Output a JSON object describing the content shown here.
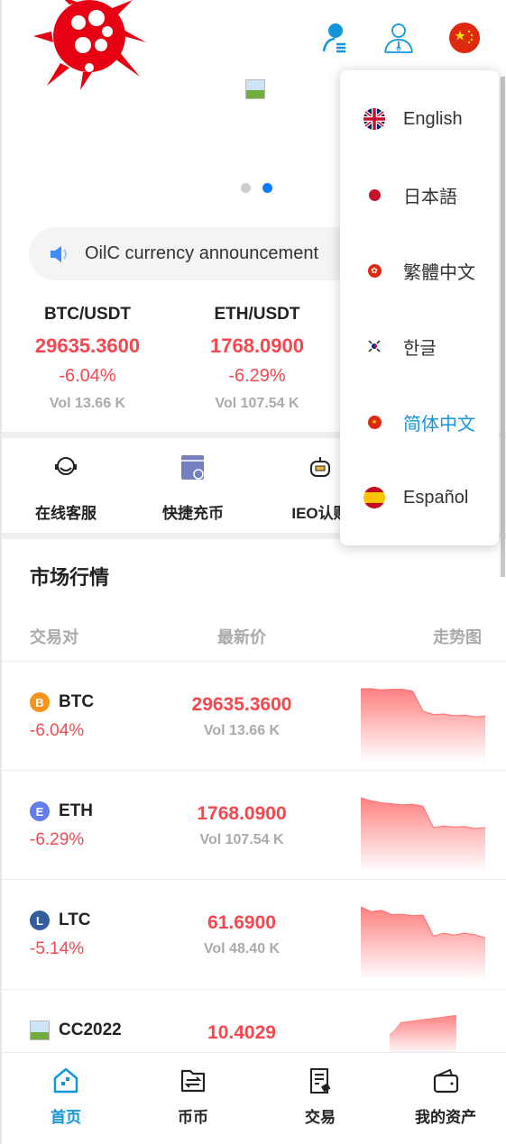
{
  "header": {
    "logo_icon": "red-splat-logo-icon",
    "icons": [
      "user-list-icon",
      "customer-service-icon",
      "china-flag-icon"
    ]
  },
  "banner": {
    "image": "broken-image-icon",
    "slides": 2,
    "active_slide": 2
  },
  "notice": {
    "icon": "speaker-icon",
    "text": "OilC currency announcement"
  },
  "tickers": [
    {
      "pair": "BTC/USDT",
      "price": "29635.3600",
      "change": "-6.04%",
      "vol": "Vol 13.66 K"
    },
    {
      "pair": "ETH/USDT",
      "price": "1768.0900",
      "change": "-6.29%",
      "vol": "Vol 107.54 K"
    }
  ],
  "quick": [
    {
      "label": "在线客服",
      "icon": "headset-icon"
    },
    {
      "label": "快捷充币",
      "icon": "deposit-card-icon"
    },
    {
      "label": "IEO认购",
      "icon": "robot-icon"
    }
  ],
  "market": {
    "title": "市场行情",
    "headers": [
      "交易对",
      "最新价",
      "走势图"
    ],
    "rows": [
      {
        "name": "BTC",
        "change": "-6.04%",
        "price": "29635.3600",
        "vol": "Vol 13.66 K",
        "color": "#f7931a",
        "trend": [
          10,
          10,
          9.8,
          9.9,
          9.9,
          9.6,
          6,
          5.4,
          5.5,
          5.2,
          5.3,
          5,
          5.1
        ]
      },
      {
        "name": "ETH",
        "change": "-6.29%",
        "price": "1768.0900",
        "vol": "Vol 107.54 K",
        "color": "#627eea",
        "trend": [
          10,
          9.4,
          9,
          8.8,
          8.6,
          8.7,
          8.3,
          4,
          4.3,
          4.1,
          4.2,
          3.8,
          4
        ]
      },
      {
        "name": "LTC",
        "change": "-5.14%",
        "price": "61.6900",
        "vol": "Vol 48.40 K",
        "color": "#345d9d",
        "trend": [
          10,
          9,
          9.3,
          8.4,
          8.5,
          8.2,
          8.3,
          4,
          4.6,
          4.2,
          4.6,
          4.3,
          3.6
        ]
      },
      {
        "name": "CC2022",
        "change": "",
        "price": "10.4029",
        "vol": "",
        "color": "",
        "trend": [
          0,
          3,
          7,
          7.4,
          7.8,
          8.2,
          8.6,
          9,
          9.4,
          9.8,
          10.2,
          10.6,
          11
        ]
      }
    ]
  },
  "nav": [
    {
      "label": "首页",
      "icon": "home-icon",
      "active": true
    },
    {
      "label": "币币",
      "icon": "exchange-folder-icon"
    },
    {
      "label": "交易",
      "icon": "trade-document-icon"
    },
    {
      "label": "我的资产",
      "icon": "wallet-icon"
    }
  ],
  "language_menu": [
    {
      "label": "English",
      "flag": "uk-flag-icon"
    },
    {
      "label": "日本語",
      "flag": "japan-flag-icon"
    },
    {
      "label": "繁體中文",
      "flag": "hong-kong-flag-icon"
    },
    {
      "label": "한글",
      "flag": "korea-flag-icon"
    },
    {
      "label": "简体中文",
      "flag": "china-flag-icon",
      "selected": true
    },
    {
      "label": "Español",
      "flag": "spain-flag-icon"
    }
  ],
  "colors": {
    "accent": "#1296db",
    "down": "#f5474e",
    "muted": "#aaaaaa"
  }
}
